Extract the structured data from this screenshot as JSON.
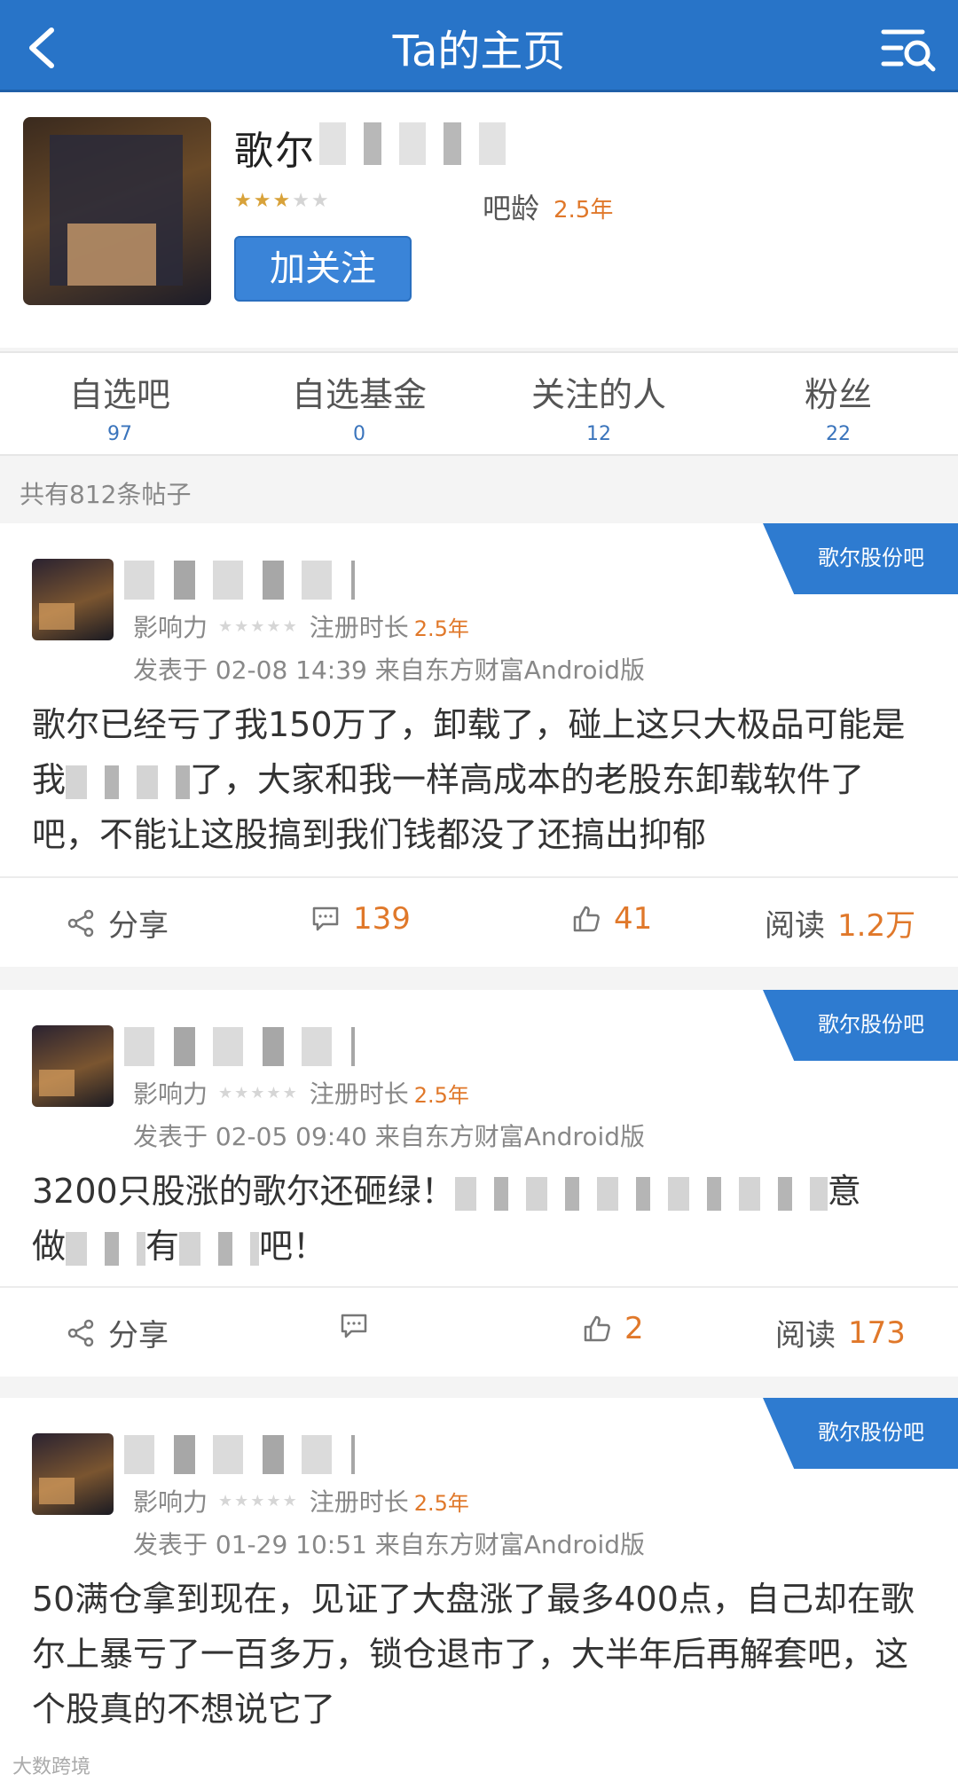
{
  "header": {
    "title": "Ta的主页"
  },
  "profile": {
    "username": "歌尔",
    "ba_age_label": "吧龄",
    "ba_age_value": "2.5年",
    "follow_label": "加关注"
  },
  "stats": [
    {
      "label": "自选吧",
      "value": "97"
    },
    {
      "label": "自选基金",
      "value": "0"
    },
    {
      "label": "关注的人",
      "value": "12"
    },
    {
      "label": "粉丝",
      "value": "22"
    }
  ],
  "post_count": "共有812条帖子",
  "posts": [
    {
      "tag": "歌尔股份吧",
      "influence_label": "影响力",
      "reg_label": "注册时长",
      "reg_value": "2.5年",
      "posted": "发表于 02-08 14:39  来自东方财富Android版",
      "content_a": "歌尔已经亏了我150万了，卸载了，碰上这只大极品可能是我",
      "content_b": "了，大家和我一样高成本的老股东卸载软件了吧，不能让这股搞到我们钱都没了还搞出抑郁",
      "share_label": "分享",
      "comments": "139",
      "likes": "41",
      "read_label": "阅读",
      "reads": "1.2万"
    },
    {
      "tag": "歌尔股份吧",
      "influence_label": "影响力",
      "reg_label": "注册时长",
      "reg_value": "2.5年",
      "posted": "发表于 02-05 09:40  来自东方财富Android版",
      "content_a": "3200只股涨的歌尔还砸绿！",
      "content_b": "意",
      "content_c": "做",
      "content_d": "有",
      "content_e": "吧！",
      "share_label": "分享",
      "comments": "",
      "likes": "2",
      "read_label": "阅读",
      "reads": "173"
    },
    {
      "tag": "歌尔股份吧",
      "influence_label": "影响力",
      "reg_label": "注册时长",
      "reg_value": "2.5年",
      "posted": "发表于 01-29 10:51  来自东方财富Android版",
      "content_a": "50满仓拿到现在，见证了大盘涨了最多400点，自己却在歌尔上暴亏了一百多万，锁仓退市了，大半年后再解套吧，这个股真的不想说它了"
    }
  ],
  "watermark": "大数跨境"
}
